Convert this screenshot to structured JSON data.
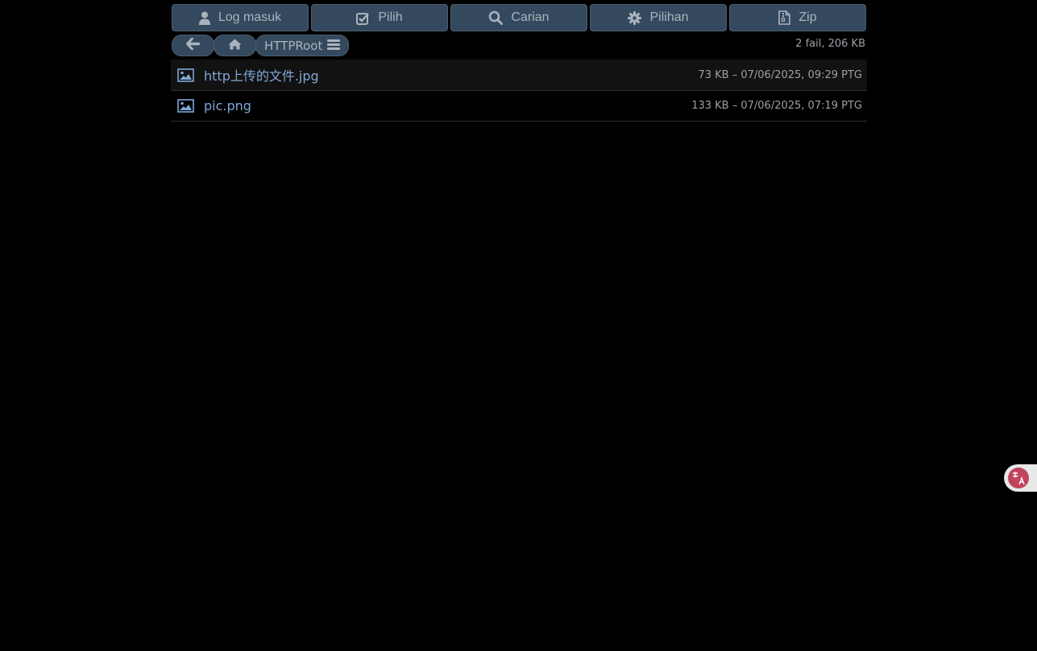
{
  "toolbar": {
    "login": {
      "label": "Log masuk",
      "icon": "user-icon"
    },
    "select": {
      "label": "Pilih",
      "icon": "check-square-icon"
    },
    "search": {
      "label": "Carian",
      "icon": "search-icon"
    },
    "options": {
      "label": "Pilihan",
      "icon": "gear-icon"
    },
    "zip": {
      "label": "Zip",
      "icon": "zip-file-icon"
    }
  },
  "nav": {
    "back_icon": "arrow-left-icon",
    "home_icon": "home-icon",
    "root_label": "HTTPRoot",
    "menu_icon": "hamburger-menu-icon"
  },
  "summary": "2 fail, 206 KB",
  "files": [
    {
      "name": "http上传的文件.jpg",
      "meta": "73 KB – 07/06/2025, 09:29 PTG",
      "icon": "image-file-icon"
    },
    {
      "name": "pic.png",
      "meta": "133 KB – 07/06/2025, 07:19 PTG",
      "icon": "image-file-icon"
    }
  ],
  "colors": {
    "background": "#000000",
    "button_bg": "#34495e",
    "link": "#7fa7d8",
    "meta_text": "#9aa0a6",
    "translate_badge": "#c0445c"
  }
}
